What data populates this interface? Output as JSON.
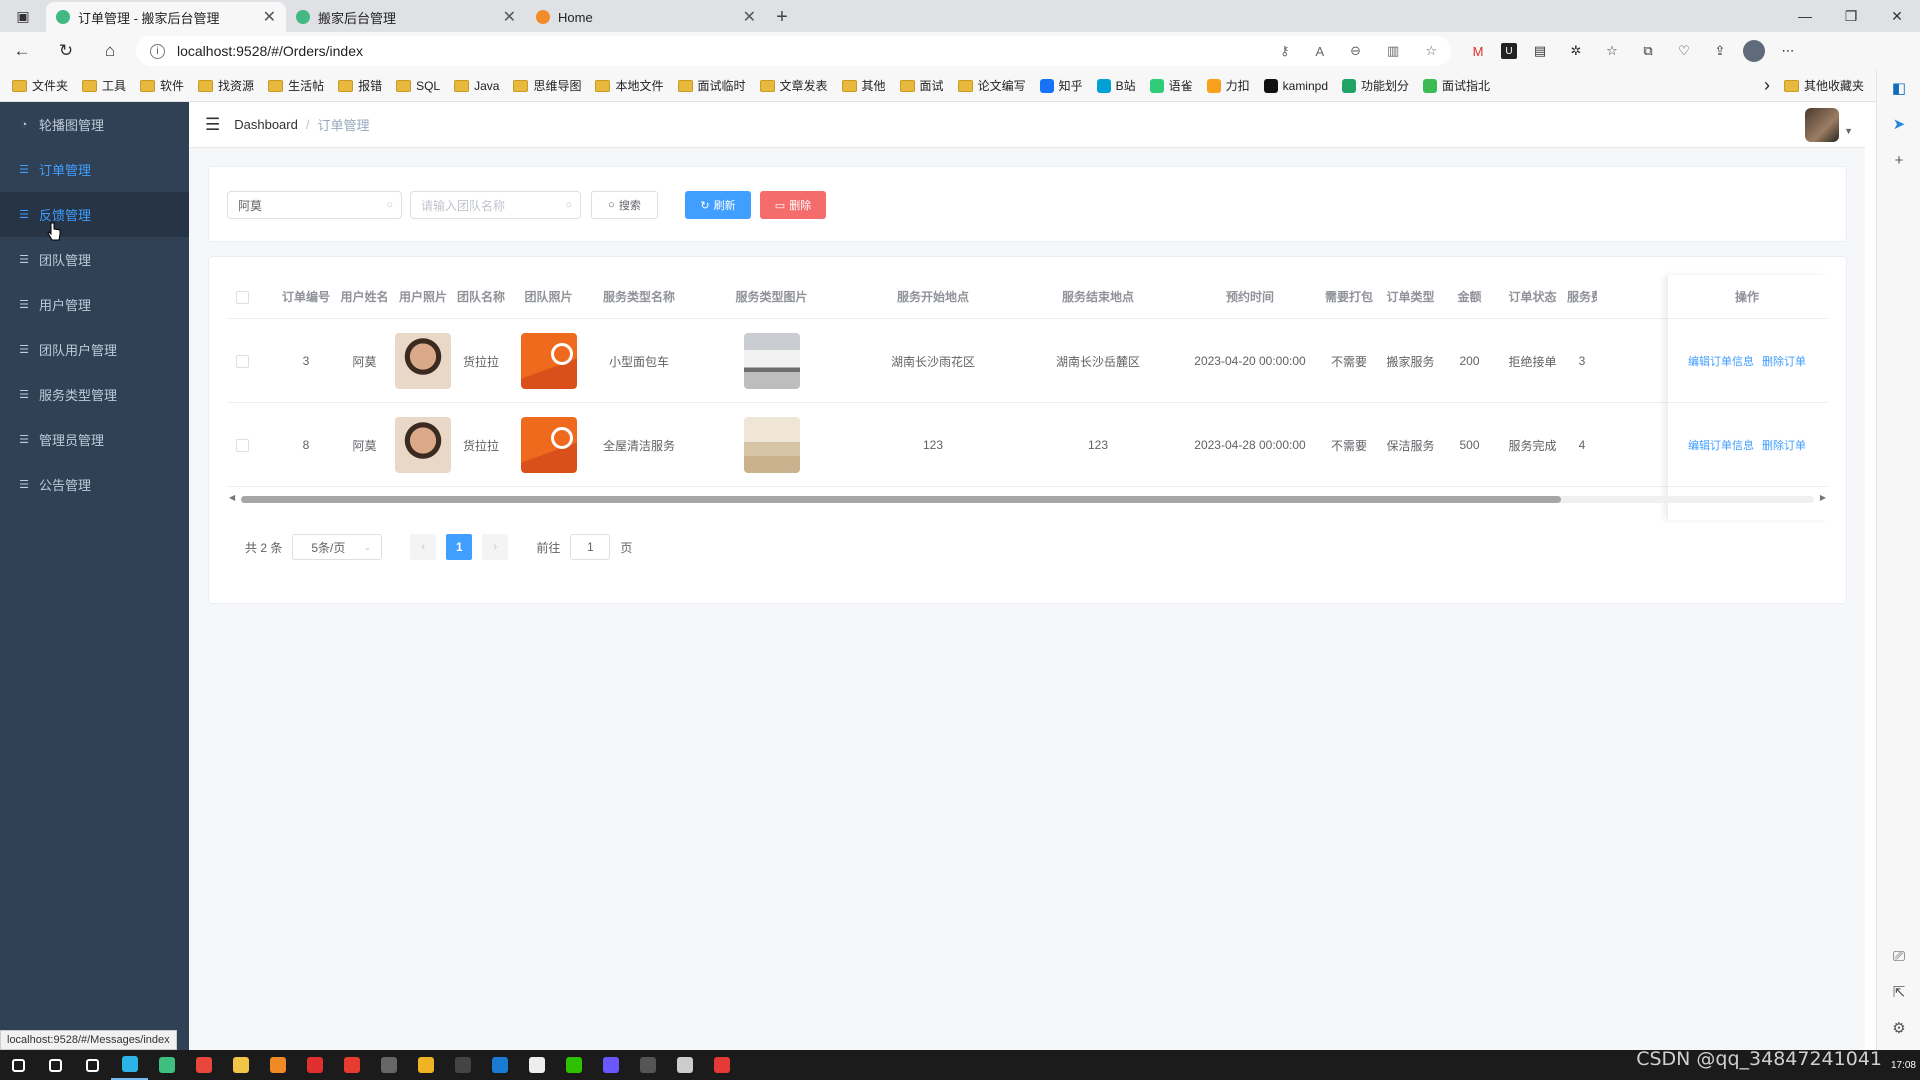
{
  "browser": {
    "tabs": [
      {
        "title": "订单管理 - 搬家后台管理",
        "active": true,
        "fav_color": "#42b883"
      },
      {
        "title": "搬家后台管理",
        "active": false,
        "fav_color": "#42b883"
      },
      {
        "title": "Home",
        "active": false,
        "fav_color": "#f28c28"
      }
    ],
    "url": "localhost:9528/#/Orders/index",
    "bookmarks": [
      {
        "label": "文件夹",
        "kind": "folder"
      },
      {
        "label": "工具",
        "kind": "folder"
      },
      {
        "label": "软件",
        "kind": "folder"
      },
      {
        "label": "找资源",
        "kind": "folder"
      },
      {
        "label": "生活帖",
        "kind": "folder"
      },
      {
        "label": "报错",
        "kind": "folder"
      },
      {
        "label": "SQL",
        "kind": "folder"
      },
      {
        "label": "Java",
        "kind": "folder"
      },
      {
        "label": "思维导图",
        "kind": "folder"
      },
      {
        "label": "本地文件",
        "kind": "folder"
      },
      {
        "label": "面试临时",
        "kind": "folder"
      },
      {
        "label": "文章发表",
        "kind": "folder"
      },
      {
        "label": "其他",
        "kind": "folder"
      },
      {
        "label": "面试",
        "kind": "folder"
      },
      {
        "label": "论文编写",
        "kind": "folder"
      },
      {
        "label": "知乎",
        "kind": "site",
        "color": "#1772f6"
      },
      {
        "label": "B站",
        "kind": "site",
        "color": "#00a1d6"
      },
      {
        "label": "语雀",
        "kind": "site",
        "color": "#31cc79"
      },
      {
        "label": "力扣",
        "kind": "site",
        "color": "#f89f1b"
      },
      {
        "label": "kaminpd",
        "kind": "site",
        "color": "#111111"
      },
      {
        "label": "功能划分",
        "kind": "site",
        "color": "#21a366"
      },
      {
        "label": "面试指北",
        "kind": "site",
        "color": "#3cba54"
      }
    ],
    "bookmarks_more": "其他收藏夹",
    "status_url": "localhost:9528/#/Messages/index"
  },
  "sidebar": {
    "items": [
      {
        "label": "轮播图管理",
        "icon": "dashboard-icon",
        "state": "normal"
      },
      {
        "label": "订单管理",
        "icon": "list-icon",
        "state": "active"
      },
      {
        "label": "反馈管理",
        "icon": "list-icon",
        "state": "hover"
      },
      {
        "label": "团队管理",
        "icon": "list-icon",
        "state": "normal"
      },
      {
        "label": "用户管理",
        "icon": "list-icon",
        "state": "normal"
      },
      {
        "label": "团队用户管理",
        "icon": "list-icon",
        "state": "normal"
      },
      {
        "label": "服务类型管理",
        "icon": "list-icon",
        "state": "normal"
      },
      {
        "label": "管理员管理",
        "icon": "list-icon",
        "state": "normal"
      },
      {
        "label": "公告管理",
        "icon": "list-icon",
        "state": "normal"
      }
    ]
  },
  "header": {
    "breadcrumb_home": "Dashboard",
    "breadcrumb_current": "订单管理"
  },
  "filters": {
    "user_value": "阿莫",
    "team_placeholder": "请输入团队名称",
    "search_label": "搜索",
    "refresh_label": "刷新",
    "delete_label": "删除"
  },
  "table": {
    "columns": [
      "订单编号",
      "用户姓名",
      "用户照片",
      "团队名称",
      "团队照片",
      "服务类型名称",
      "服务类型图片",
      "服务开始地点",
      "服务结束地点",
      "预约时间",
      "需要打包",
      "订单类型",
      "金额",
      "订单状态",
      "服务费",
      "操作"
    ],
    "rows": [
      {
        "id": "3",
        "user": "阿莫",
        "team": "货拉拉",
        "service": "小型面包车",
        "service_img": "van",
        "start": "湖南长沙雨花区",
        "end": "湖南长沙岳麓区",
        "time": "2023-04-20 00:00:00",
        "pack": "不需要",
        "type": "搬家服务",
        "amount": "200",
        "status": "拒绝接单",
        "fee": "3"
      },
      {
        "id": "8",
        "user": "阿莫",
        "team": "货拉拉",
        "service": "全屋清洁服务",
        "service_img": "clean",
        "start": "123",
        "end": "123",
        "time": "2023-04-28 00:00:00",
        "pack": "不需要",
        "type": "保洁服务",
        "amount": "500",
        "status": "服务完成",
        "fee": "4"
      }
    ],
    "edit_label": "编辑订单信息",
    "delete_label": "删除订单"
  },
  "pagination": {
    "total": "共 2 条",
    "page_size": "5条/页",
    "current_page": "1",
    "goto_prefix": "前往",
    "goto_value": "1",
    "goto_suffix": "页"
  },
  "watermark": "CSDN @qq_34847241041",
  "clock": "17:08"
}
